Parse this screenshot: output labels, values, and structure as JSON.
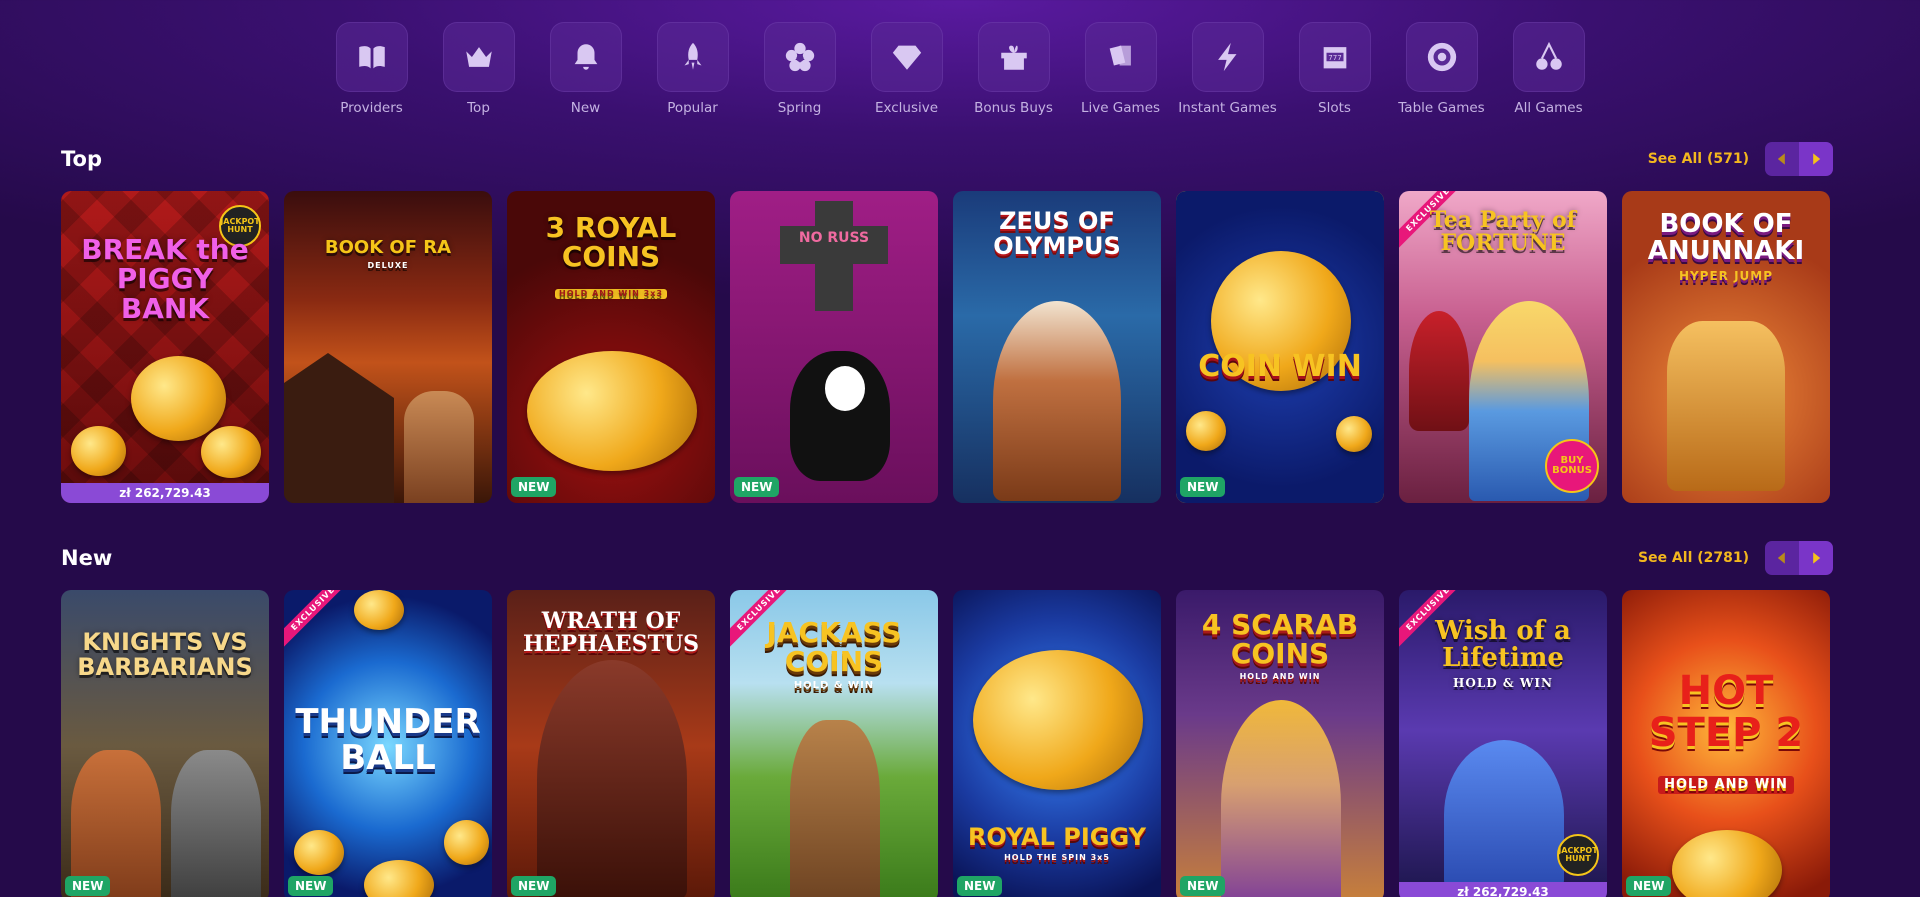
{
  "categories": [
    {
      "label": "Providers",
      "icon": "book-icon"
    },
    {
      "label": "Top",
      "icon": "crown-icon"
    },
    {
      "label": "New",
      "icon": "bell-icon"
    },
    {
      "label": "Popular",
      "icon": "rocket-icon"
    },
    {
      "label": "Spring",
      "icon": "flower-icon"
    },
    {
      "label": "Exclusive",
      "icon": "diamond-icon"
    },
    {
      "label": "Bonus Buys",
      "icon": "gift-icon"
    },
    {
      "label": "Live Games",
      "icon": "cards-icon"
    },
    {
      "label": "Instant Games",
      "icon": "lightning-icon"
    },
    {
      "label": "Slots",
      "icon": "slot-machine-icon"
    },
    {
      "label": "Table Games",
      "icon": "poker-chip-icon"
    },
    {
      "label": "All Games",
      "icon": "cherries-icon"
    }
  ],
  "sections": {
    "top": {
      "title": "Top",
      "see_all": "See All (571)",
      "games": [
        {
          "title": "BREAK the PIGGY BANK",
          "badge": "",
          "jackpot": "zł 262,729.43",
          "exclusive": "",
          "logo": "JACKPOT HUNT"
        },
        {
          "title": "BOOK OF RA",
          "sub": "DELUXE",
          "badge": "",
          "jackpot": "",
          "exclusive": ""
        },
        {
          "title": "3 ROYAL COINS",
          "sub": "HOLD AND WIN 3x3",
          "badge": "NEW",
          "jackpot": "",
          "exclusive": ""
        },
        {
          "title": "NO RUSS",
          "badge": "NEW",
          "jackpot": "",
          "exclusive": ""
        },
        {
          "title": "ZEUS OF OLYMPUS",
          "badge": "",
          "jackpot": "",
          "exclusive": ""
        },
        {
          "title": "COIN WIN",
          "badge": "NEW",
          "jackpot": "",
          "exclusive": ""
        },
        {
          "title": "Tea Party of FORTUNE",
          "badge": "",
          "jackpot": "",
          "exclusive": "EXCLUSIVE",
          "logo": "BUY BONUS"
        },
        {
          "title": "BOOK OF ANUNNAKI",
          "sub": "HYPER JUMP",
          "badge": "",
          "jackpot": "",
          "exclusive": ""
        }
      ]
    },
    "new": {
      "title": "New",
      "see_all": "See All (2781)",
      "games": [
        {
          "title": "KNIGHTS VS BARBARIANS",
          "badge": "NEW",
          "jackpot": "",
          "exclusive": ""
        },
        {
          "title": "THUNDER BALL",
          "badge": "NEW",
          "jackpot": "",
          "exclusive": "EXCLUSIVE"
        },
        {
          "title": "WRATH OF HEPHAESTUS",
          "badge": "NEW",
          "jackpot": "",
          "exclusive": ""
        },
        {
          "title": "JACKASS COINS",
          "sub": "HOLD & WIN",
          "badge": "",
          "jackpot": "",
          "exclusive": "EXCLUSIVE"
        },
        {
          "title": "ROYAL PIGGY",
          "sub": "HOLD THE SPIN 3x5",
          "badge": "NEW",
          "jackpot": "",
          "exclusive": ""
        },
        {
          "title": "4 SCARAB COINS",
          "sub": "HOLD AND WIN",
          "badge": "NEW",
          "jackpot": "",
          "exclusive": ""
        },
        {
          "title": "Wish of a Lifetime",
          "sub": "HOLD & WIN",
          "badge": "",
          "jackpot": "zł 262,729.43",
          "exclusive": "EXCLUSIVE",
          "logo": "JACKPOT HUNT"
        },
        {
          "title": "HOT STEP 2",
          "sub": "HOLD AND WIN",
          "badge": "NEW",
          "jackpot": "",
          "exclusive": ""
        }
      ]
    }
  },
  "colors": {
    "accent": "#f3b71e",
    "new_badge": "#1fa565",
    "jackpot_bar": "#8a4ad6",
    "exclusive_ribbon": "#e8177a",
    "selected_outline": "#f5c518"
  }
}
